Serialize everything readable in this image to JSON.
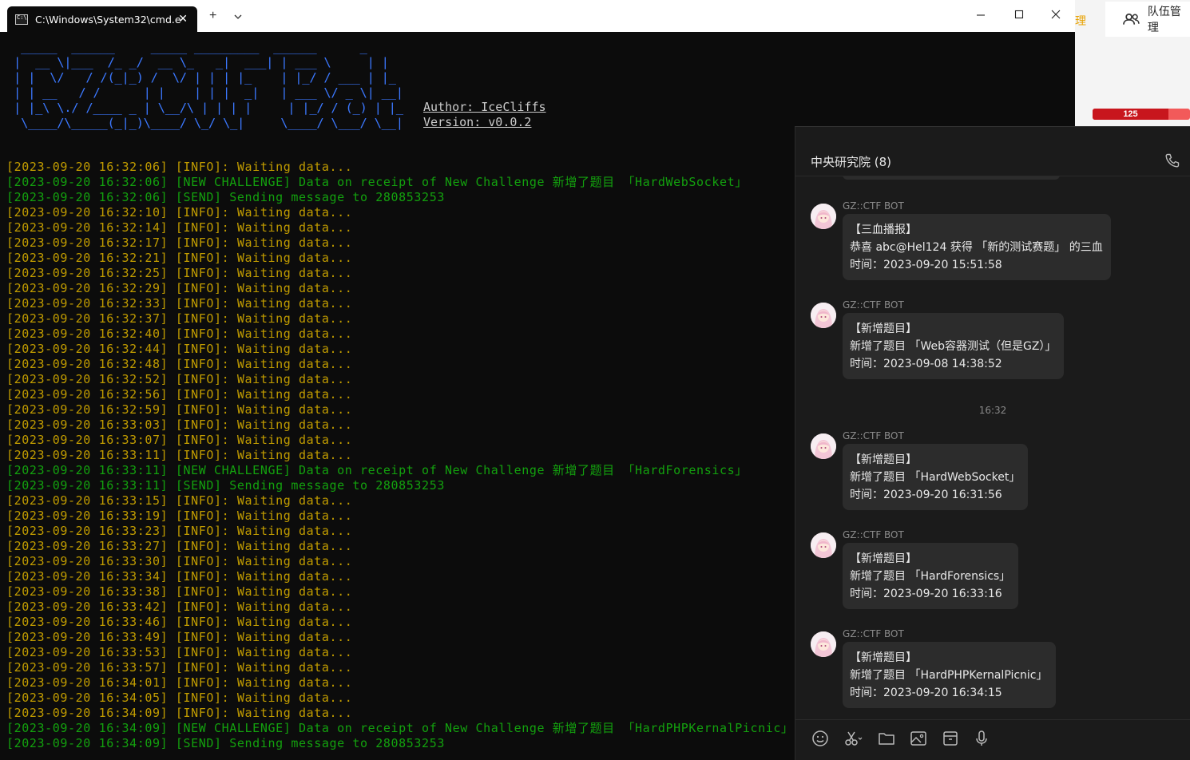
{
  "window": {
    "tab_title": "C:\\Windows\\System32\\cmd.e",
    "tab_close": "✕",
    "new_tab": "+",
    "dropdown": "⌄",
    "minimize": "—",
    "maximize": "☐",
    "close": "✕"
  },
  "background_app": {
    "manage_fragment": "理",
    "team_tab_label": "队伍管理",
    "progress_value": "125",
    "progress_fraction": 0.78,
    "progress_color": "#c8161d"
  },
  "banner": {
    "ascii": [
      "  _____  ______     _____ _________  ______      _",
      " |  __ \\|___  /_ _/  __ \\_   _|  ___| | ___ \\     | |",
      " | |  \\/   / /(_|_) /  \\/ | | | |_    | |_/ / ___ | |_",
      " | | __   / /      | |    | | |  _|   | ___ \\/ _ \\| __|",
      " | |_\\ \\./ /____ _ | \\__/\\ | | | |     | |_/ / (_) | |_",
      "  \\____/\\_____(_|_)\\____/ \\_/ \\_|     \\____/ \\___/ \\__|"
    ],
    "author": "Author: IceCliffs",
    "version": "Version: v0.0.2"
  },
  "log": [
    {
      "text": "[2023-09-20 16:32:06] [INFO]: Waiting data...",
      "type": "info"
    },
    {
      "text": "[2023-09-20 16:32:06] [NEW CHALLENGE] Data on receipt of New Challenge 新增了题目 「HardWebSocket」",
      "type": "new"
    },
    {
      "text": "[2023-09-20 16:32:06] [SEND] Sending message to 280853253",
      "type": "send"
    },
    {
      "text": "[2023-09-20 16:32:10] [INFO]: Waiting data...",
      "type": "info"
    },
    {
      "text": "[2023-09-20 16:32:14] [INFO]: Waiting data...",
      "type": "info"
    },
    {
      "text": "[2023-09-20 16:32:17] [INFO]: Waiting data...",
      "type": "info"
    },
    {
      "text": "[2023-09-20 16:32:21] [INFO]: Waiting data...",
      "type": "info"
    },
    {
      "text": "[2023-09-20 16:32:25] [INFO]: Waiting data...",
      "type": "info"
    },
    {
      "text": "[2023-09-20 16:32:29] [INFO]: Waiting data...",
      "type": "info"
    },
    {
      "text": "[2023-09-20 16:32:33] [INFO]: Waiting data...",
      "type": "info"
    },
    {
      "text": "[2023-09-20 16:32:37] [INFO]: Waiting data...",
      "type": "info"
    },
    {
      "text": "[2023-09-20 16:32:40] [INFO]: Waiting data...",
      "type": "info"
    },
    {
      "text": "[2023-09-20 16:32:44] [INFO]: Waiting data...",
      "type": "info"
    },
    {
      "text": "[2023-09-20 16:32:48] [INFO]: Waiting data...",
      "type": "info"
    },
    {
      "text": "[2023-09-20 16:32:52] [INFO]: Waiting data...",
      "type": "info"
    },
    {
      "text": "[2023-09-20 16:32:56] [INFO]: Waiting data...",
      "type": "info"
    },
    {
      "text": "[2023-09-20 16:32:59] [INFO]: Waiting data...",
      "type": "info"
    },
    {
      "text": "[2023-09-20 16:33:03] [INFO]: Waiting data...",
      "type": "info"
    },
    {
      "text": "[2023-09-20 16:33:07] [INFO]: Waiting data...",
      "type": "info"
    },
    {
      "text": "[2023-09-20 16:33:11] [INFO]: Waiting data...",
      "type": "info"
    },
    {
      "text": "[2023-09-20 16:33:11] [NEW CHALLENGE] Data on receipt of New Challenge 新增了题目 「HardForensics」",
      "type": "new"
    },
    {
      "text": "[2023-09-20 16:33:11] [SEND] Sending message to 280853253",
      "type": "send"
    },
    {
      "text": "[2023-09-20 16:33:15] [INFO]: Waiting data...",
      "type": "info"
    },
    {
      "text": "[2023-09-20 16:33:19] [INFO]: Waiting data...",
      "type": "info"
    },
    {
      "text": "[2023-09-20 16:33:23] [INFO]: Waiting data...",
      "type": "info"
    },
    {
      "text": "[2023-09-20 16:33:27] [INFO]: Waiting data...",
      "type": "info"
    },
    {
      "text": "[2023-09-20 16:33:30] [INFO]: Waiting data...",
      "type": "info"
    },
    {
      "text": "[2023-09-20 16:33:34] [INFO]: Waiting data...",
      "type": "info"
    },
    {
      "text": "[2023-09-20 16:33:38] [INFO]: Waiting data...",
      "type": "info"
    },
    {
      "text": "[2023-09-20 16:33:42] [INFO]: Waiting data...",
      "type": "info"
    },
    {
      "text": "[2023-09-20 16:33:46] [INFO]: Waiting data...",
      "type": "info"
    },
    {
      "text": "[2023-09-20 16:33:49] [INFO]: Waiting data...",
      "type": "info"
    },
    {
      "text": "[2023-09-20 16:33:53] [INFO]: Waiting data...",
      "type": "info"
    },
    {
      "text": "[2023-09-20 16:33:57] [INFO]: Waiting data...",
      "type": "info"
    },
    {
      "text": "[2023-09-20 16:34:01] [INFO]: Waiting data...",
      "type": "info"
    },
    {
      "text": "[2023-09-20 16:34:05] [INFO]: Waiting data...",
      "type": "info"
    },
    {
      "text": "[2023-09-20 16:34:09] [INFO]: Waiting data...",
      "type": "info"
    },
    {
      "text": "[2023-09-20 16:34:09] [NEW CHALLENGE] Data on receipt of New Challenge 新增了题目 「HardPHPKernalPicnic」",
      "type": "new"
    },
    {
      "text": "[2023-09-20 16:34:09] [SEND] Sending message to 280853253",
      "type": "send"
    }
  ],
  "chat": {
    "title": "中央研究院 (8)",
    "messages": [
      {
        "sender": "GZ::CTF BOT",
        "lines": [
          "【三血播报】",
          "恭喜 abc@Hel124 获得 「新的测试赛题」 的三血",
          "时间：2023-09-20 15:51:58"
        ]
      },
      {
        "sender": "GZ::CTF BOT",
        "lines": [
          "【新增题目】",
          "新增了题目 「Web容器测试（但是GZ）」",
          "时间：2023-09-08 14:38:52"
        ]
      },
      {
        "sender": "GZ::CTF BOT",
        "lines": [
          "【新增题目】",
          "新增了题目 「HardWebSocket」",
          "时间：2023-09-20 16:31:56"
        ]
      },
      {
        "sender": "GZ::CTF BOT",
        "lines": [
          "【新增题目】",
          "新增了题目 「HardForensics」",
          "时间：2023-09-20 16:33:16"
        ]
      },
      {
        "sender": "GZ::CTF BOT",
        "lines": [
          "【新增题目】",
          "新增了题目 「HardPHPKernalPicnic」",
          "时间：2023-09-20 16:34:15"
        ]
      }
    ],
    "time_separator": "16:32",
    "toolbar_icons": [
      "emoji-icon",
      "scissors-icon",
      "folder-icon",
      "image-icon",
      "box-icon",
      "microphone-icon"
    ]
  },
  "colors": {
    "info": "#c19c00",
    "new": "#13a10e",
    "send": "#13a10e",
    "banner": "#3b78ff"
  }
}
